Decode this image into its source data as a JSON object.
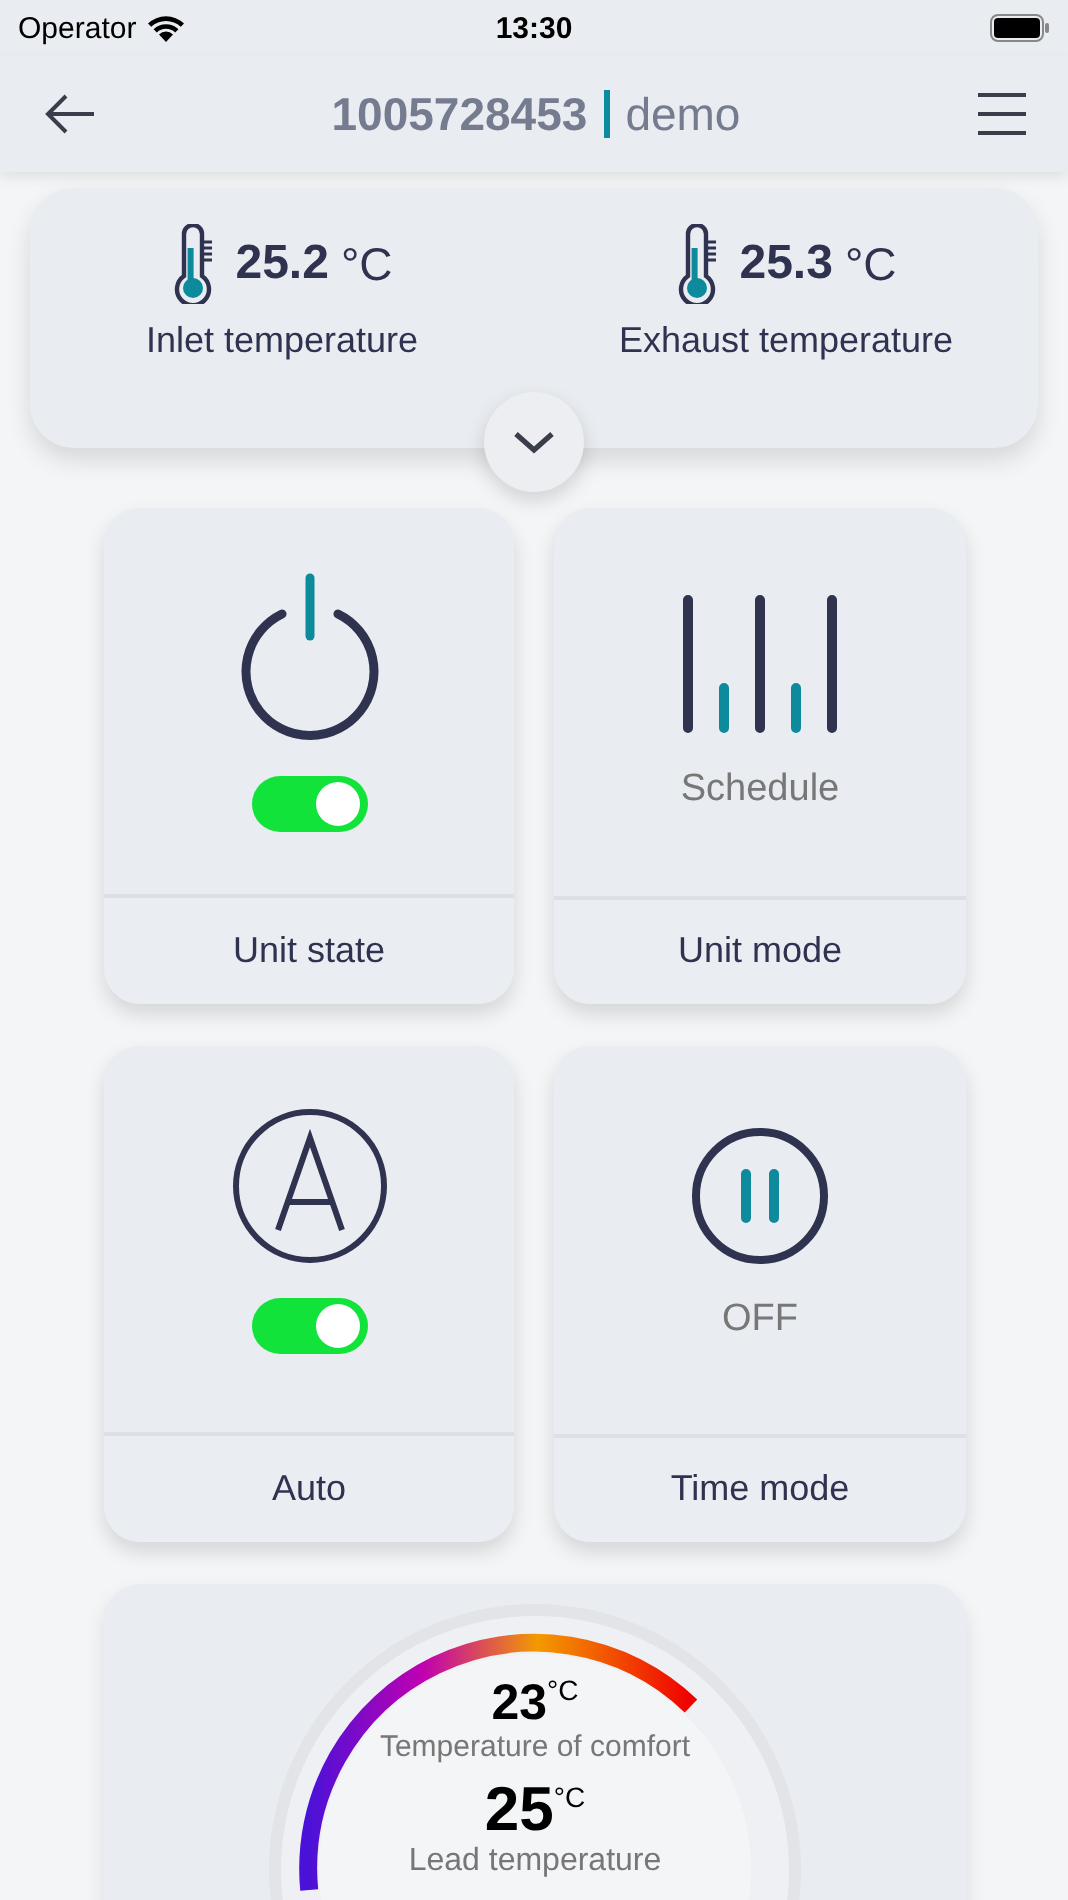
{
  "status_bar": {
    "carrier": "Operator",
    "time": "13:30"
  },
  "nav": {
    "device_id": "1005728453",
    "name": "demo"
  },
  "sensors": [
    {
      "value": "25.2",
      "unit": "°C",
      "label": "Inlet temperature"
    },
    {
      "value": "25.3",
      "unit": "°C",
      "label": "Exhaust temperature"
    }
  ],
  "tiles": [
    {
      "kind": "toggle",
      "on": true,
      "label": "Unit state"
    },
    {
      "kind": "status",
      "status": "Schedule",
      "label": "Unit mode"
    },
    {
      "kind": "toggle",
      "on": true,
      "label": "Auto"
    },
    {
      "kind": "status",
      "status": "OFF",
      "label": "Time mode"
    }
  ],
  "dial": {
    "readings": [
      {
        "value": "23",
        "unit": "°C",
        "label": "Temperature of comfort"
      },
      {
        "value": "25",
        "unit": "°C",
        "label": "Lead temperature"
      }
    ]
  }
}
